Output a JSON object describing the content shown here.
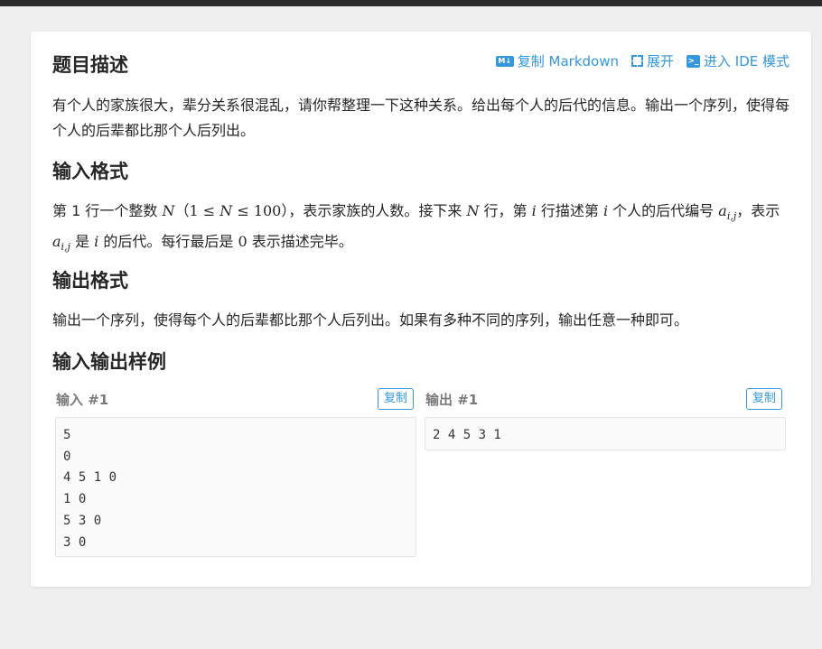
{
  "header": {
    "title": "题目描述",
    "actions": {
      "copy_markdown": "复制 Markdown",
      "expand": "展开",
      "enter_ide": "进入 IDE 模式"
    },
    "md_icon_text": "M↓",
    "term_icon_text": ">_"
  },
  "description": {
    "text": "有个人的家族很大，辈分关系很混乱，请你帮整理一下这种关系。给出每个人的后代的信息。输出一个序列，使得每个人的后辈都比那个人后列出。"
  },
  "input_format": {
    "title": "输入格式",
    "t1": "第 1 行一个整数 ",
    "var_N": "N",
    "range_open": "（",
    "range_1": "1",
    "le": " ≤ ",
    "range_100": "100",
    "range_close": "）",
    "t2": "，表示家族的人数。接下来 ",
    "t3": " 行，第 ",
    "var_i": "i",
    "t4": " 行描述第 ",
    "t5": " 个人的后代编号 ",
    "var_a": "a",
    "sub_ij": "i,j",
    "t6": "，表示 ",
    "t7": " 是 ",
    "t8": " 的后代。每行最后是 ",
    "zero": "0",
    "t9": " 表示描述完毕。"
  },
  "output_format": {
    "title": "输出格式",
    "text": "输出一个序列，使得每个人的后辈都比那个人后列出。如果有多种不同的序列，输出任意一种即可。"
  },
  "samples": {
    "title": "输入输出样例",
    "copy_label": "复制",
    "input": {
      "label": "输入 #1",
      "lines": [
        "5",
        "0",
        "4 5 1 0",
        "1 0",
        "5 3 0",
        "3 0"
      ]
    },
    "output": {
      "label": "输出 #1",
      "lines": [
        "2 4 5 3 1"
      ]
    }
  },
  "colors": {
    "accent": "#3498db",
    "page_bg": "#efefef",
    "card_bg": "#ffffff",
    "code_bg": "#fafafa"
  }
}
